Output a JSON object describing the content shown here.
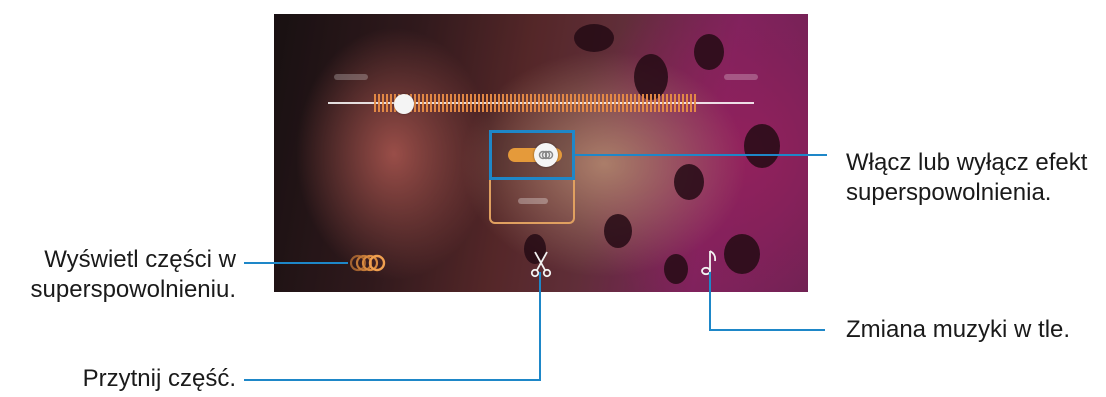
{
  "callouts": {
    "toggle_line1": "Włącz lub wyłącz efekt",
    "toggle_line2": "superspowolnienia.",
    "sections_line1": "Wyświetl części w",
    "sections_line2": "superspowolnieniu.",
    "trim": "Przytnij część.",
    "music": "Zmiana muzyki w tle."
  },
  "icons": {
    "sections": "slow-motion-sections-icon",
    "trim": "scissors-icon",
    "music": "music-note-icon",
    "toggle": "slow-motion-toggle"
  },
  "toggle": {
    "state": "on"
  },
  "colors": {
    "callout_line": "#1e87c8",
    "accent": "#e59a3a",
    "text": "#1a1a1a"
  }
}
